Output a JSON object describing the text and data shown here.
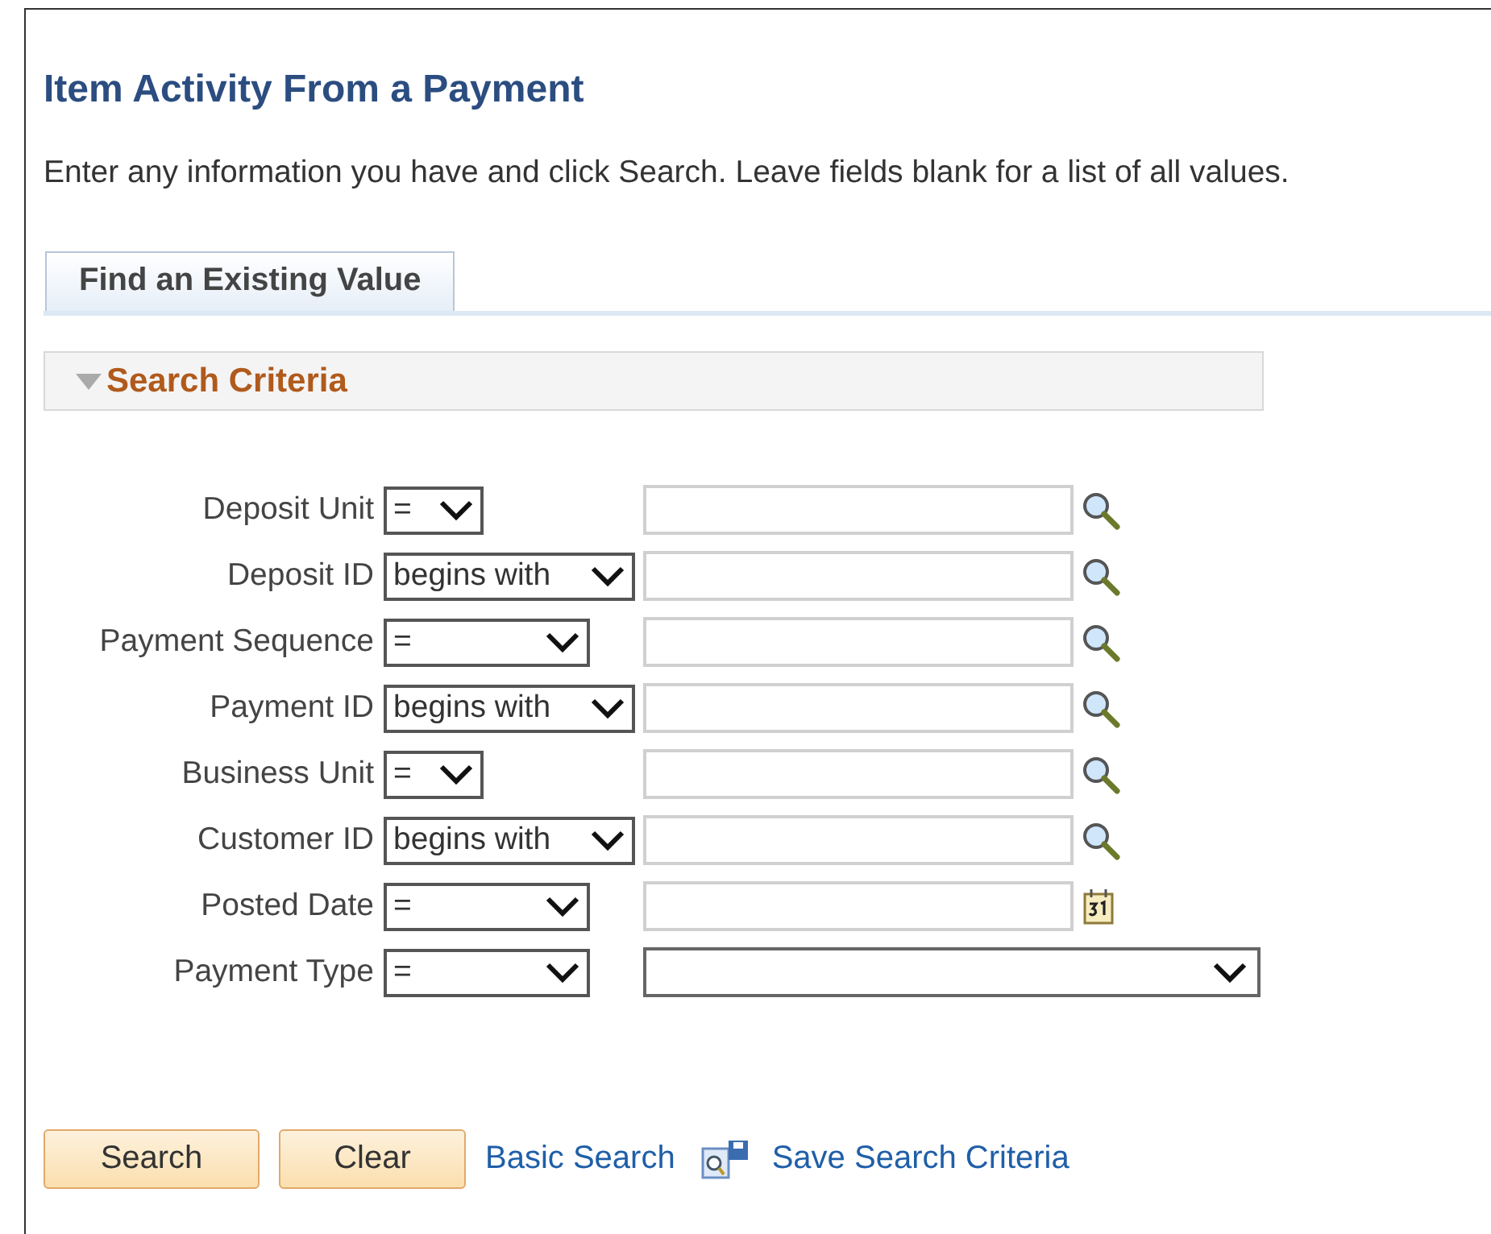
{
  "title": "Item Activity From a Payment",
  "instructions": "Enter any information you have and click Search. Leave fields blank for a list of all values.",
  "tabs": [
    {
      "label": "Find an Existing Value",
      "selected": true
    }
  ],
  "section": {
    "title": "Search Criteria",
    "expanded": true
  },
  "criteria": [
    {
      "label": "Deposit Unit",
      "operator": {
        "value": "=",
        "kind": "narrow"
      },
      "kind": "lookup"
    },
    {
      "label": "Deposit ID",
      "operator": {
        "value": "begins with",
        "kind": "wide"
      },
      "kind": "lookup"
    },
    {
      "label": "Payment Sequence",
      "operator": {
        "value": "=",
        "kind": "medium"
      },
      "kind": "lookup"
    },
    {
      "label": "Payment ID",
      "operator": {
        "value": "begins with",
        "kind": "wide"
      },
      "kind": "lookup"
    },
    {
      "label": "Business Unit",
      "operator": {
        "value": "=",
        "kind": "narrow"
      },
      "kind": "lookup"
    },
    {
      "label": "Customer ID",
      "operator": {
        "value": "begins with",
        "kind": "wide"
      },
      "kind": "lookup"
    },
    {
      "label": "Posted Date",
      "operator": {
        "value": "=",
        "kind": "medium"
      },
      "kind": "date"
    },
    {
      "label": "Payment Type",
      "operator": {
        "value": "=",
        "kind": "medium"
      },
      "kind": "dropdown"
    }
  ],
  "buttons": [
    "Search",
    "Clear"
  ],
  "links": [
    {
      "label": "Basic Search",
      "kind": "plain"
    },
    {
      "label": "Save Search Criteria",
      "kind": "save"
    }
  ]
}
